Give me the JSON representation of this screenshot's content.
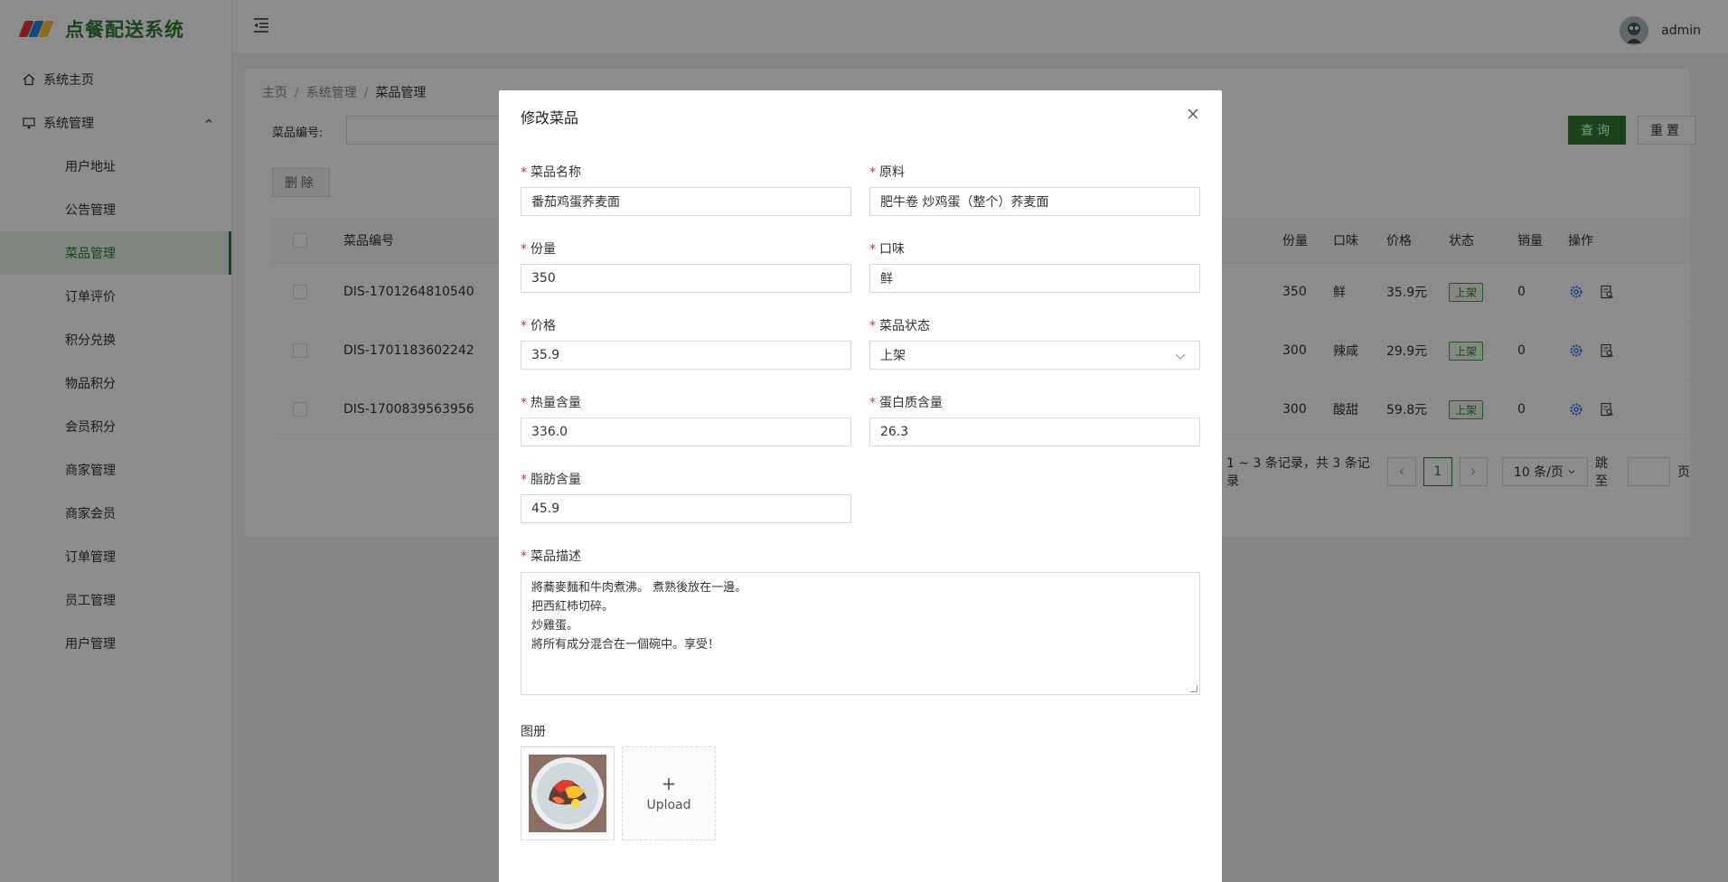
{
  "app": {
    "title": "点餐配送系统"
  },
  "header": {
    "username": "admin"
  },
  "sidebar": {
    "home_label": "系统主页",
    "group_label": "系统管理",
    "items": [
      {
        "label": "用户地址"
      },
      {
        "label": "公告管理"
      },
      {
        "label": "菜品管理"
      },
      {
        "label": "订单评价"
      },
      {
        "label": "积分兑换"
      },
      {
        "label": "物品积分"
      },
      {
        "label": "会员积分"
      },
      {
        "label": "商家管理"
      },
      {
        "label": "商家会员"
      },
      {
        "label": "订单管理"
      },
      {
        "label": "员工管理"
      },
      {
        "label": "用户管理"
      }
    ],
    "active_index": 2
  },
  "breadcrumb": {
    "home": "主页",
    "sep": "/",
    "section": "系统管理",
    "current": "菜品管理"
  },
  "search": {
    "label": "菜品编号:",
    "value": "",
    "query_button": "查询",
    "reset_button": "重置"
  },
  "toolbar": {
    "delete_button": "删除"
  },
  "table": {
    "columns": {
      "code": "菜品编号",
      "portion": "份量",
      "taste": "口味",
      "price": "价格",
      "status": "状态",
      "sales": "销量",
      "actions": "操作"
    },
    "rows": [
      {
        "code": "DIS-1701264810540",
        "portion": "350",
        "taste": "鲜",
        "price": "35.9元",
        "status": "上架",
        "sales": "0"
      },
      {
        "code": "DIS-1701183602242",
        "portion": "300",
        "taste": "辣咸",
        "price": "29.9元",
        "status": "上架",
        "sales": "0"
      },
      {
        "code": "DIS-1700839563956",
        "portion": "300",
        "taste": "酸甜",
        "price": "59.8元",
        "status": "上架",
        "sales": "0"
      }
    ]
  },
  "pagination": {
    "summary": "1 ~ 3 条记录，共 3 条记录",
    "current_page": "1",
    "page_size": "10 条/页",
    "jump_label": "跳至",
    "page_suffix": "页"
  },
  "modal": {
    "title": "修改菜品",
    "required_mark": "*",
    "fields": {
      "name": {
        "label": "菜品名称",
        "value": "番茄鸡蛋荞麦面"
      },
      "ingredients": {
        "label": "原料",
        "value": "肥牛卷 炒鸡蛋（整个）荞麦面"
      },
      "portion": {
        "label": "份量",
        "value": "350"
      },
      "taste": {
        "label": "口味",
        "value": "鲜"
      },
      "price": {
        "label": "价格",
        "value": "35.9"
      },
      "status": {
        "label": "菜品状态",
        "value": "上架"
      },
      "calories": {
        "label": "热量含量",
        "value": "336.0"
      },
      "protein": {
        "label": "蛋白质含量",
        "value": "26.3"
      },
      "fat": {
        "label": "脂肪含量",
        "value": "45.9"
      },
      "description": {
        "label": "菜品描述",
        "value": "將蕎麥麵和牛肉煮沸。 煮熟後放在一邊。\n把西紅柿切碎。\n炒雞蛋。\n將所有成分混合在一個碗中。享受！"
      }
    },
    "gallery": {
      "label": "图册",
      "upload_label": "Upload",
      "upload_plus": "+"
    }
  },
  "colors": {
    "brand": "#2e7d32",
    "required": "#f5222d",
    "action_icon": "#1677ff"
  }
}
